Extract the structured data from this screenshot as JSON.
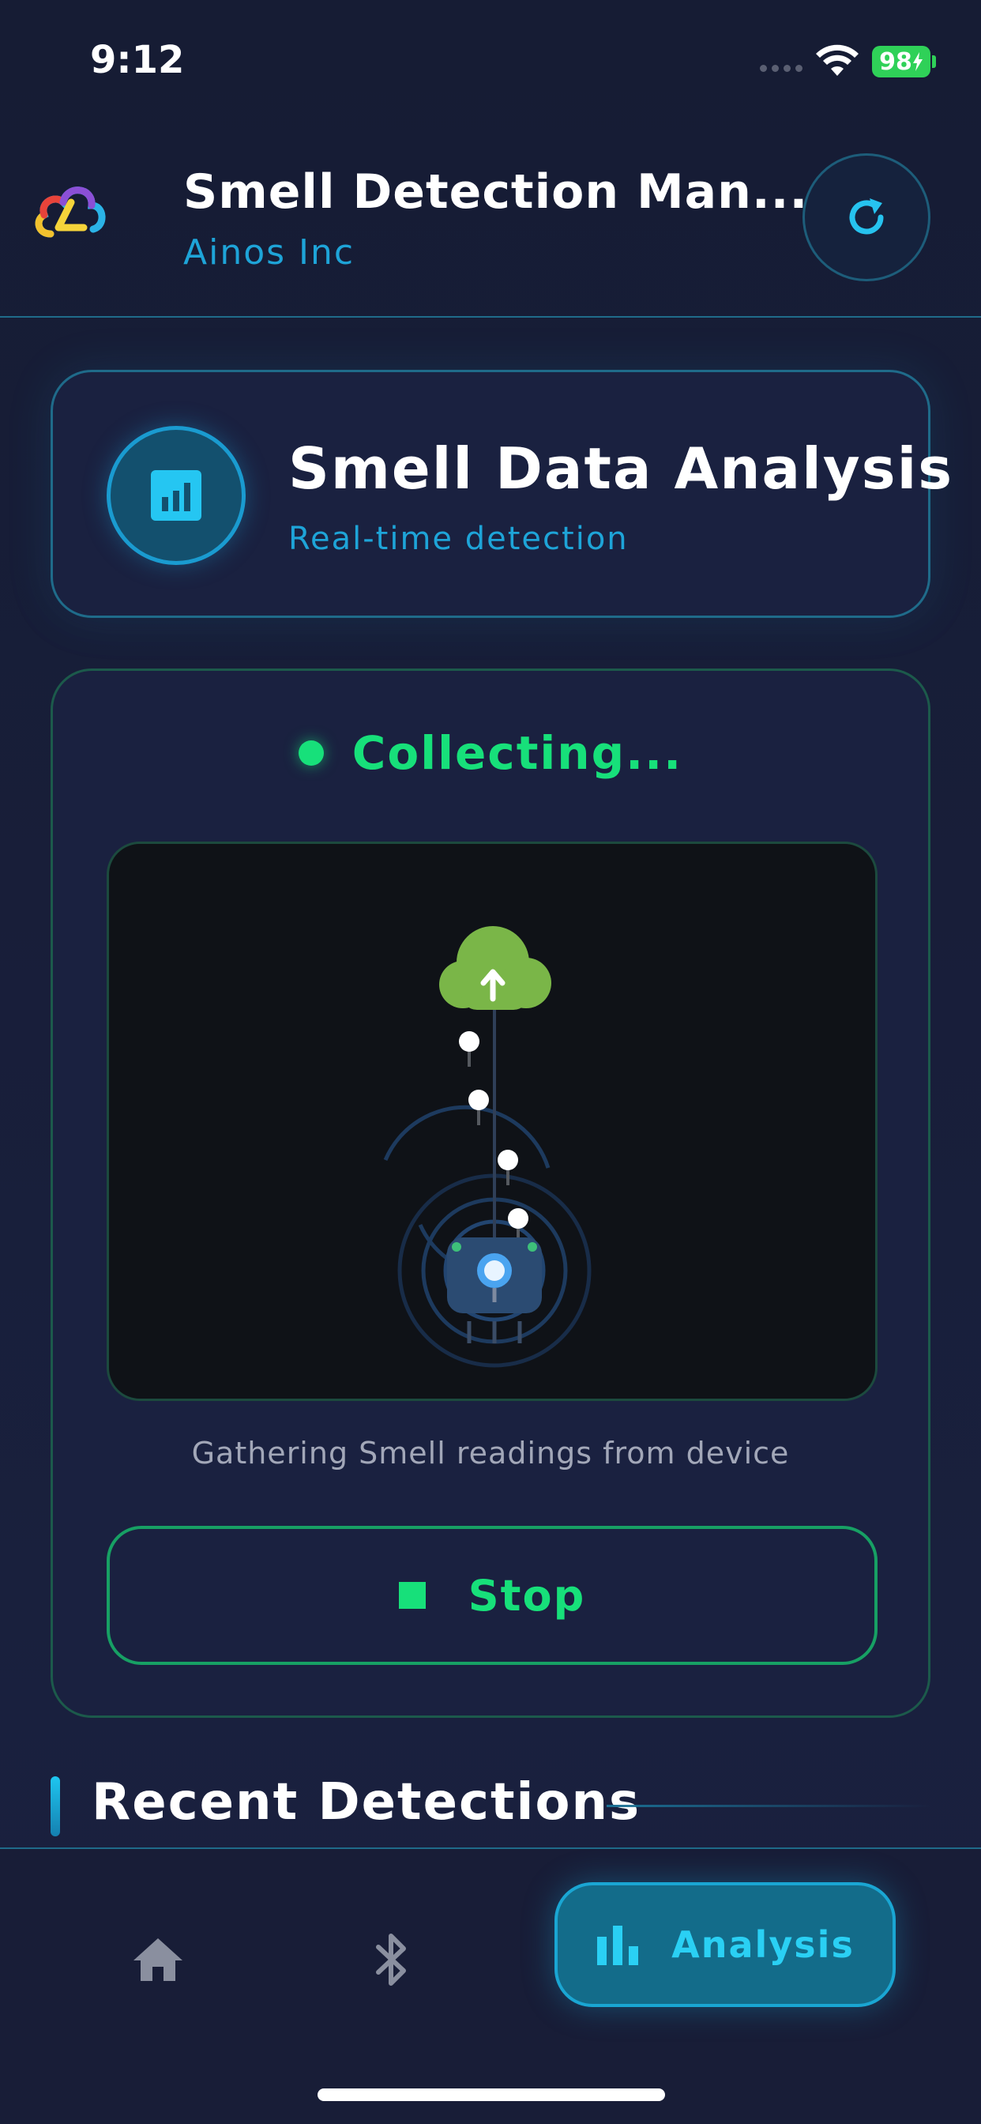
{
  "status_bar": {
    "time": "9:12",
    "battery": "98"
  },
  "header": {
    "app_title": "Smell Detection Man...",
    "company": "Ainos Inc",
    "logo_icon": "cloud-logo-icon",
    "refresh_icon": "refresh-icon"
  },
  "analysis_card": {
    "title": "Smell Data Analysis",
    "subtitle": "Real-time detection",
    "icon": "bar-chart-icon"
  },
  "collecting": {
    "status": "Collecting...",
    "caption": "Gathering Smell readings from device",
    "stop_label": "Stop"
  },
  "recent": {
    "title": "Recent Detections"
  },
  "bottom_nav": {
    "items": [
      {
        "icon": "home-icon",
        "label": ""
      },
      {
        "icon": "bluetooth-icon",
        "label": ""
      },
      {
        "icon": "bar-chart-icon",
        "label": "Analysis"
      }
    ],
    "active": "Analysis"
  },
  "colors": {
    "accent_cyan": "#1ea4d8",
    "accent_green": "#17e07a",
    "background": "#171d36"
  }
}
